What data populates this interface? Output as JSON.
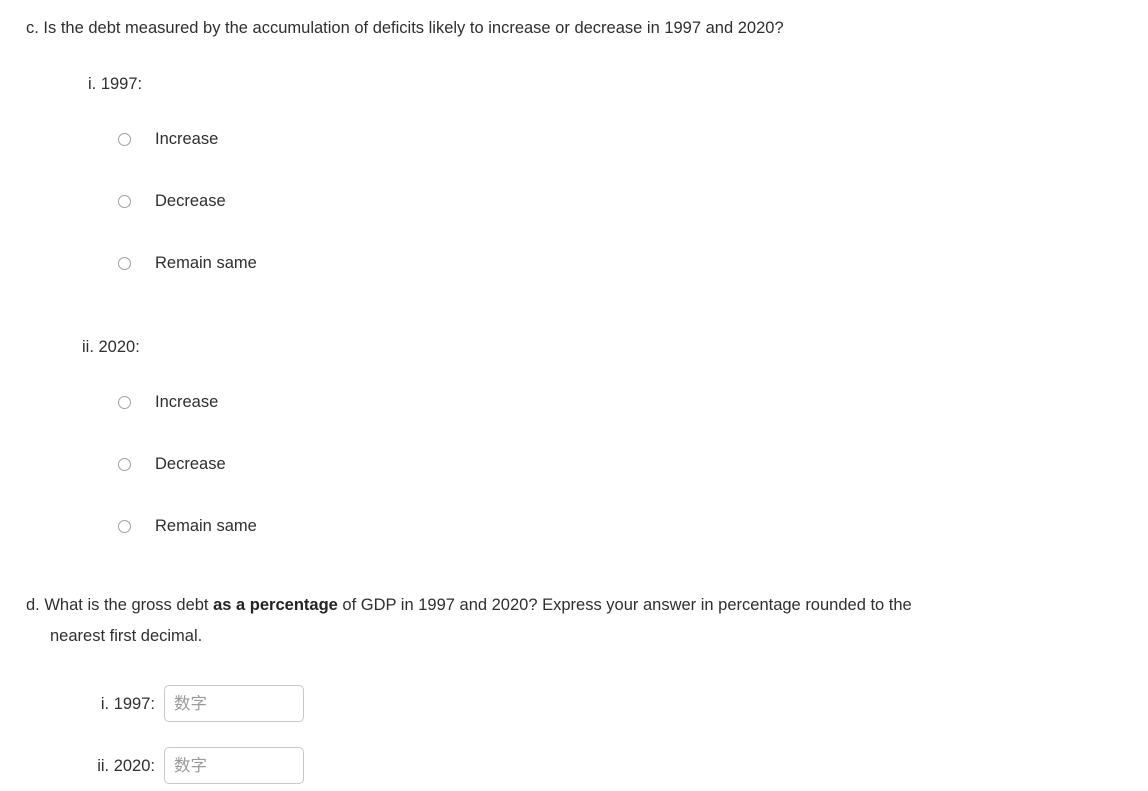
{
  "page": {
    "background_color": "#ffffff",
    "text_color": "#2f2f2f"
  },
  "question_c": {
    "text": "c. Is the debt measured by the accumulation of deficits likely to increase or decrease in 1997 and 2020?",
    "subquestions": [
      {
        "label": "i. 1997:",
        "options": [
          {
            "label": "Increase",
            "selected": false
          },
          {
            "label": "Decrease",
            "selected": false
          },
          {
            "label": "Remain same",
            "selected": false
          }
        ]
      },
      {
        "label": "ii. 2020:",
        "options": [
          {
            "label": "Increase",
            "selected": false
          },
          {
            "label": "Decrease",
            "selected": false
          },
          {
            "label": "Remain same",
            "selected": false
          }
        ]
      }
    ]
  },
  "question_d": {
    "line1_part1": "d. What is the gross debt ",
    "line1_bold": "as a percentage",
    "line1_part2": " of GDP in 1997 and 2020? Express your answer in percentage rounded to the",
    "line2": "nearest first decimal.",
    "answers": [
      {
        "label": "i. 1997:",
        "value": "",
        "placeholder": "数字"
      },
      {
        "label": "ii. 2020:",
        "value": "",
        "placeholder": "数字"
      }
    ]
  }
}
